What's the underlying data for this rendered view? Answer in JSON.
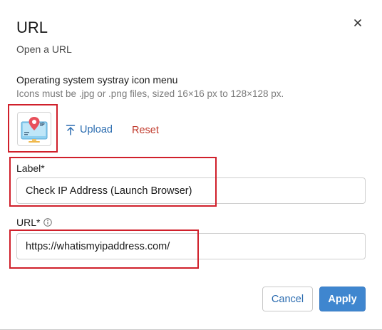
{
  "dialog": {
    "title": "URL",
    "subtitle": "Open a URL",
    "close_icon": "close-icon"
  },
  "icon_section": {
    "label": "Operating system systray icon menu",
    "help": "Icons must be .jpg or .png files, sized 16×16 px to 128×128 px.",
    "icon_name": "ip-address-monitor-icon",
    "icon_badge_text": "IP",
    "upload_label": "Upload",
    "reset_label": "Reset"
  },
  "label_field": {
    "label": "Label*",
    "value": "Check IP Address (Launch Browser)"
  },
  "url_field": {
    "label": "URL*",
    "value": "https://whatismyipaddress.com/",
    "info_icon": "info-icon"
  },
  "actions": {
    "cancel_label": "Cancel",
    "apply_label": "Apply"
  },
  "colors": {
    "accent": "#3f86cf",
    "link": "#2b6cb0",
    "danger": "#c0392b",
    "highlight": "#d0202b"
  }
}
